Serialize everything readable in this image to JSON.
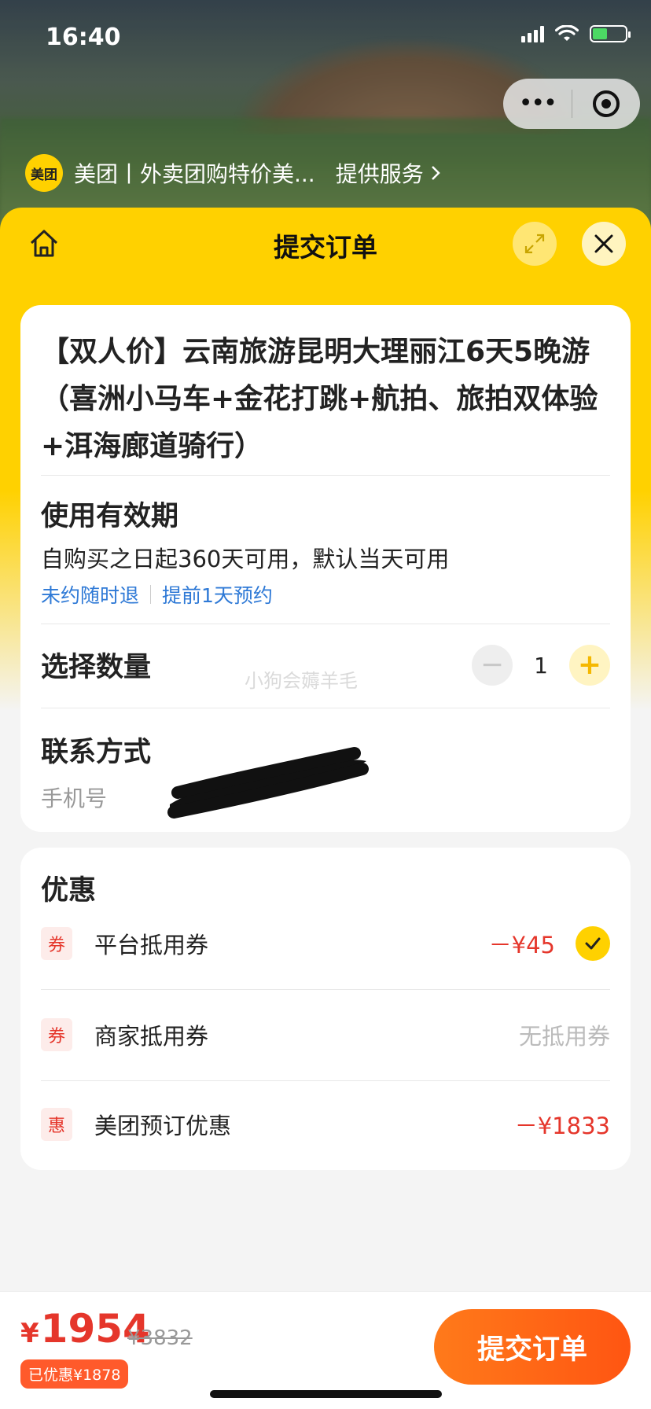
{
  "status_bar": {
    "time": "16:40"
  },
  "miniapp": {
    "brand_logo_text": "美团",
    "brand_name": "美团丨外卖团购特价美...",
    "service_link": "提供服务"
  },
  "header": {
    "title": "提交订单"
  },
  "product": {
    "title": "【双人价】云南旅游昆明大理丽江6天5晚游（喜洲小马车+金花打跳+航拍、旅拍双体验+洱海廊道骑行）"
  },
  "validity": {
    "label": "使用有效期",
    "text": "自购买之日起360天可用，默认当天可用",
    "tags": [
      "未约随时退",
      "提前1天预约"
    ]
  },
  "quantity": {
    "label": "选择数量",
    "value": "1",
    "minus": "−",
    "plus": "+"
  },
  "watermark": "小狗会薅羊毛",
  "contact": {
    "label": "联系方式",
    "phone_label": "手机号"
  },
  "discounts": {
    "title": "优惠",
    "items": [
      {
        "icon": "券",
        "name": "平台抵用券",
        "value": "－¥45",
        "checked": true
      },
      {
        "icon": "券",
        "name": "商家抵用券",
        "value": "无抵用券"
      },
      {
        "icon": "惠",
        "name": "美团预订优惠",
        "value": "－¥1833"
      }
    ]
  },
  "footer": {
    "currency": "¥",
    "price": "1954",
    "original_price": "¥3832",
    "saved": "已优惠¥1878",
    "submit_label": "提交订单"
  },
  "colors": {
    "brand_yellow": "#ffd100",
    "price_red": "#e5362b",
    "link_blue": "#2e79d6",
    "submit_orange": "#ff5a14"
  }
}
